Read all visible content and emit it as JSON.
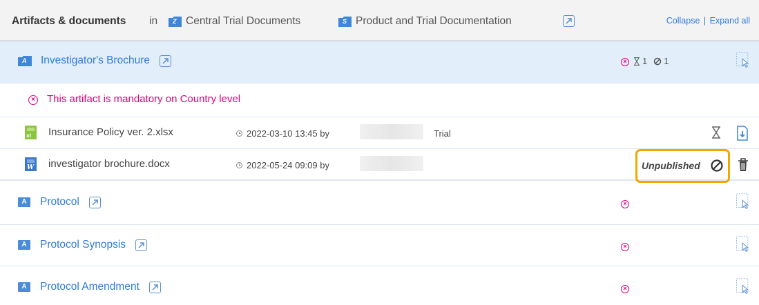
{
  "header": {
    "title": "Artifacts & documents",
    "in_word": "in",
    "crumbs": [
      {
        "letter": "Z",
        "label": "Central Trial Documents"
      },
      {
        "letter": "S",
        "label": "Product and Trial Documentation"
      }
    ],
    "collapse_label": "Collapse",
    "separator": "|",
    "expand_all_label": "Expand all"
  },
  "sections": [
    {
      "badge": "A",
      "label": "Investigator's Brochure",
      "selected": true,
      "counts": {
        "pending": "1",
        "unpublished": "1"
      }
    },
    {
      "badge": "A",
      "label": "Protocol"
    },
    {
      "badge": "A",
      "label": "Protocol Synopsis"
    },
    {
      "badge": "A",
      "label": "Protocol Amendment"
    }
  ],
  "mandatory_notice": "This artifact is mandatory on Country level",
  "documents": [
    {
      "name": "Insurance Policy ver. 2.xlsx",
      "file_type": "xlsx",
      "meta": "2022-03-10 13:45 by",
      "level": "Trial"
    },
    {
      "name": "investigator brochure.docx",
      "file_type": "docx",
      "meta": "2022-05-24 09:09 by",
      "status": "Unpublished"
    }
  ],
  "colors": {
    "link": "#2f7bd8",
    "mandatory": "#e4007c",
    "highlight": "#f0a800",
    "selected_bg": "#e3eefb"
  }
}
